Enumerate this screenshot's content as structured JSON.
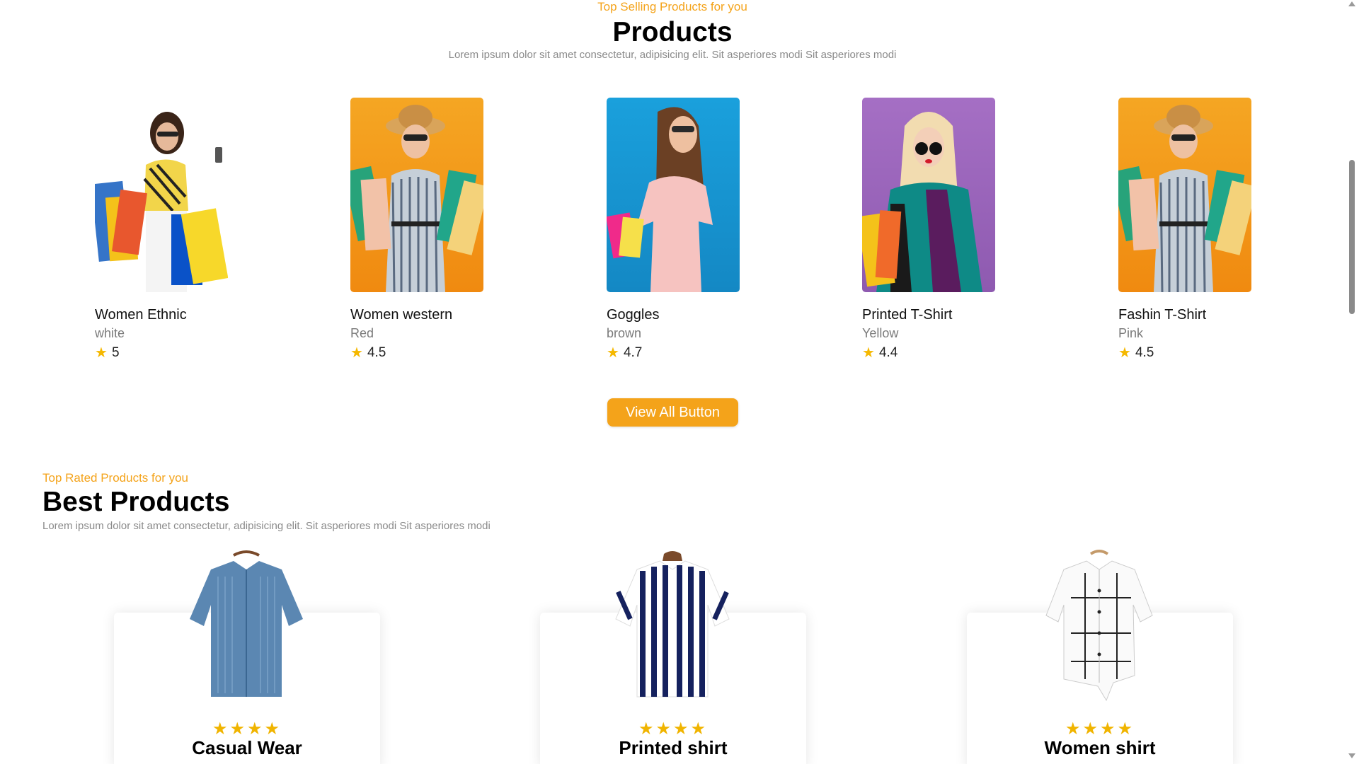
{
  "products_section": {
    "tagline": "Top Selling Products for you",
    "title": "Products",
    "description": "Lorem ipsum dolor sit amet consectetur, adipisicing elit. Sit asperiores modi Sit asperiores modi",
    "items": [
      {
        "name": "Women Ethnic",
        "color": "white",
        "rating": "5"
      },
      {
        "name": "Women western",
        "color": "Red",
        "rating": "4.5"
      },
      {
        "name": "Goggles",
        "color": "brown",
        "rating": "4.7"
      },
      {
        "name": "Printed T-Shirt",
        "color": "Yellow",
        "rating": "4.4"
      },
      {
        "name": "Fashin T-Shirt",
        "color": "Pink",
        "rating": "4.5"
      }
    ],
    "view_all_label": "View All Button"
  },
  "best_section": {
    "tagline": "Top Rated Products for you",
    "title": "Best Products",
    "description": "Lorem ipsum dolor sit amet consectetur, adipisicing elit. Sit asperiores modi Sit asperiores modi",
    "cards": [
      {
        "name": "Casual Wear",
        "stars": "★★★★"
      },
      {
        "name": "Printed shirt",
        "stars": "★★★★"
      },
      {
        "name": "Women shirt",
        "stars": "★★★★"
      }
    ]
  },
  "colors": {
    "accent": "#f4a31a",
    "star": "#f5b800",
    "img_bg_orange": "#f5a623",
    "img_bg_blue": "#1e9fd6",
    "img_bg_purple": "#9b6ab8"
  },
  "icons": {
    "rating_star": "star-icon",
    "scroll_up": "chevron-up-icon",
    "scroll_down": "chevron-down-icon"
  }
}
